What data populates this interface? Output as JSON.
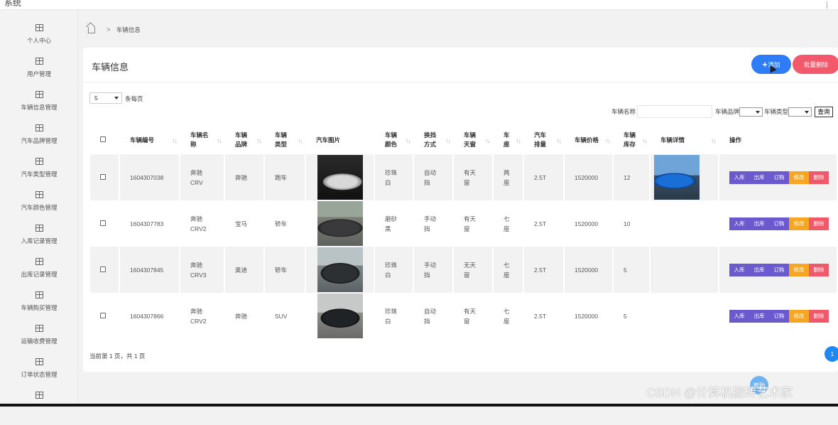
{
  "window": {
    "title": "系统"
  },
  "sidebar": {
    "items": [
      {
        "label": "个人中心"
      },
      {
        "label": "用户管理"
      },
      {
        "label": "车辆信息管理"
      },
      {
        "label": "汽车品牌管理"
      },
      {
        "label": "汽车类型管理"
      },
      {
        "label": "汽车颜色管理"
      },
      {
        "label": "入库记录管理"
      },
      {
        "label": "出库记录管理"
      },
      {
        "label": "车辆购买管理"
      },
      {
        "label": "运输收费管理"
      },
      {
        "label": "订单状态管理"
      },
      {
        "label": ""
      }
    ]
  },
  "breadcrumb": {
    "separator": ">",
    "current": "车辆信息"
  },
  "header": {
    "title": "车辆信息",
    "add_label": "添加",
    "batch_delete_label": "批量删除"
  },
  "page_size": {
    "value": "5",
    "label": "条每页"
  },
  "filters": {
    "name_label": "车辆名称",
    "brand_label": "车辆品牌",
    "type_label": "车辆类型",
    "search_label": "查询"
  },
  "table": {
    "headers": {
      "id": "车辆编号",
      "name": "车辆名称",
      "brand": "车辆品牌",
      "type": "车辆类型",
      "image": "汽车图片",
      "color": "车辆颜色",
      "gear": "换挡方式",
      "sunroof": "车辆天窗",
      "seats": "车座",
      "displacement": "汽车排量",
      "price": "车辆价格",
      "stock": "车辆库存",
      "detail": "车辆详情",
      "ops": "操作"
    },
    "sort_glyph": "↑↓",
    "op_labels": {
      "in": "入库",
      "out": "出库",
      "order": "订购",
      "edit": "修改",
      "delete": "删除"
    },
    "op_colors": {
      "in": "#6a5acd",
      "out": "#6a5acd",
      "order": "#6a5acd",
      "edit": "#f5a623",
      "delete": "#ef5a6b"
    },
    "rows": [
      {
        "id": "1604307038",
        "name": "奔驰CRV",
        "brand": "奔驰",
        "type": "跑车",
        "color": "珍珠白",
        "gear": "自动挡",
        "sunroof": "有天窗",
        "seats": "两座",
        "displacement": "2.5T",
        "price": "1520000",
        "stock": "12",
        "image": "white-sportscar-photo",
        "detail": "blue-supercar-photo"
      },
      {
        "id": "1604307783",
        "name": "奔驰CRV2",
        "brand": "宝马",
        "type": "轿车",
        "color": "磨砂黑",
        "gear": "手动挡",
        "sunroof": "有天窗",
        "seats": "七座",
        "displacement": "2.5T",
        "price": "1520000",
        "stock": "10",
        "image": "dark-sedan-photo",
        "detail": ""
      },
      {
        "id": "1604307845",
        "name": "奔驰CRV3",
        "brand": "奥迪",
        "type": "轿车",
        "color": "珍珠白",
        "gear": "手动挡",
        "sunroof": "无天窗",
        "seats": "七座",
        "displacement": "2.5T",
        "price": "1520000",
        "stock": "5",
        "image": "dark-suv-photo",
        "detail": ""
      },
      {
        "id": "1604307866",
        "name": "奔驰CRV2",
        "brand": "奔驰",
        "type": "SUV",
        "color": "珍珠白",
        "gear": "自动挡",
        "sunroof": "有天窗",
        "seats": "七座",
        "displacement": "2.5T",
        "price": "1520000",
        "stock": "5",
        "image": "black-suv-photo",
        "detail": ""
      }
    ]
  },
  "pager": {
    "summary": "当前第 1 页，共 1 页",
    "page": "1"
  },
  "float_button": {
    "label": "帮助"
  },
  "watermark": "CSDN @计算机搬砖艺术家"
}
